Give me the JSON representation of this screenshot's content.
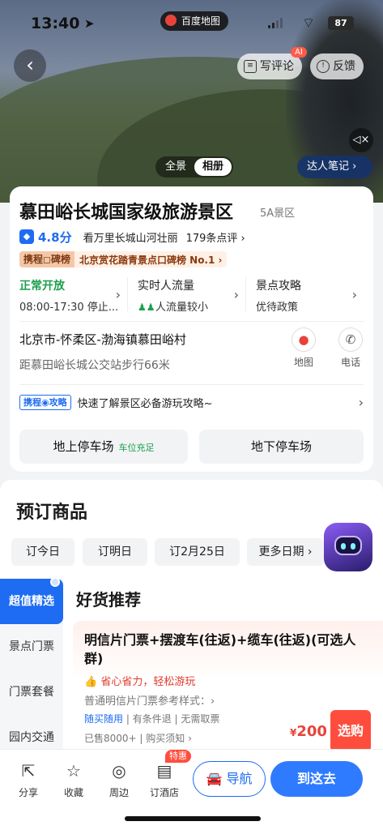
{
  "status_bar": {
    "time": "13:40",
    "location_arrow": "➤",
    "app_label": "百度地图",
    "battery": "87"
  },
  "hero": {
    "write_review": "写评论",
    "ai_badge": "AI",
    "feedback": "反馈",
    "view_tabs": [
      "全景",
      "相册"
    ],
    "active_view": "相册",
    "notes_button": "达人笔记 ›"
  },
  "poi": {
    "name": "慕田峪长城国家级旅游景区",
    "grade": "5A景区",
    "score": "4.8分",
    "slogan": "看万里长城山河壮丽",
    "reviews": "179条点评 ›",
    "rank_source": "携程◻碑榜",
    "rank_text": "北京赏花踏青景点口碑榜 No.1 ›",
    "status_label": "正常开放",
    "hours": "08:00-17:30 停止...",
    "flow_label": "实时人流量",
    "flow_value": "人流量较小",
    "guide_label": "景点攻略",
    "guide_value": "优待政策",
    "address": "北京市-怀柔区-渤海镇慕田峪村",
    "distance": "距慕田峪长城公交站步行66米",
    "map_label": "地图",
    "phone_label": "电话",
    "strategy_tag": "携程◉攻略",
    "strategy_text": "快速了解景区必备游玩攻略~",
    "parking_up": "地上停车场",
    "parking_up_status": "车位充足",
    "parking_down": "地下停车场"
  },
  "booking": {
    "title": "预订商品",
    "dates": [
      "订今日",
      "订明日",
      "订2月25日",
      "更多日期 ›"
    ],
    "side_tabs": [
      "超值精选",
      "景点门票",
      "门票套餐",
      "园内交通"
    ],
    "good_title": "好货推荐",
    "product": {
      "name": "明信片门票+摆渡车(往返)+缆车(往返)(可选人群)",
      "slogan": "👍 省心省力，轻松游玩",
      "ref": "普通明信片门票参考样式：›",
      "tag1": "随买随用",
      "tag2": "有条件退",
      "tag3": "无需取票",
      "sold": "已售8000+ | 购买须知 ›",
      "price_symbol": "¥",
      "price": "200",
      "buy": "选购"
    }
  },
  "bottom_bar": {
    "share": "分享",
    "collect": "收藏",
    "nearby": "周边",
    "hotel": "订酒店",
    "hotel_tag": "特惠",
    "navigate": "导航",
    "go": "到这去"
  },
  "colors": {
    "accent": "#1e6cf2",
    "open_green": "#1a9f4d",
    "price_red": "#e8433a",
    "buy_red": "#ff4d3d"
  }
}
